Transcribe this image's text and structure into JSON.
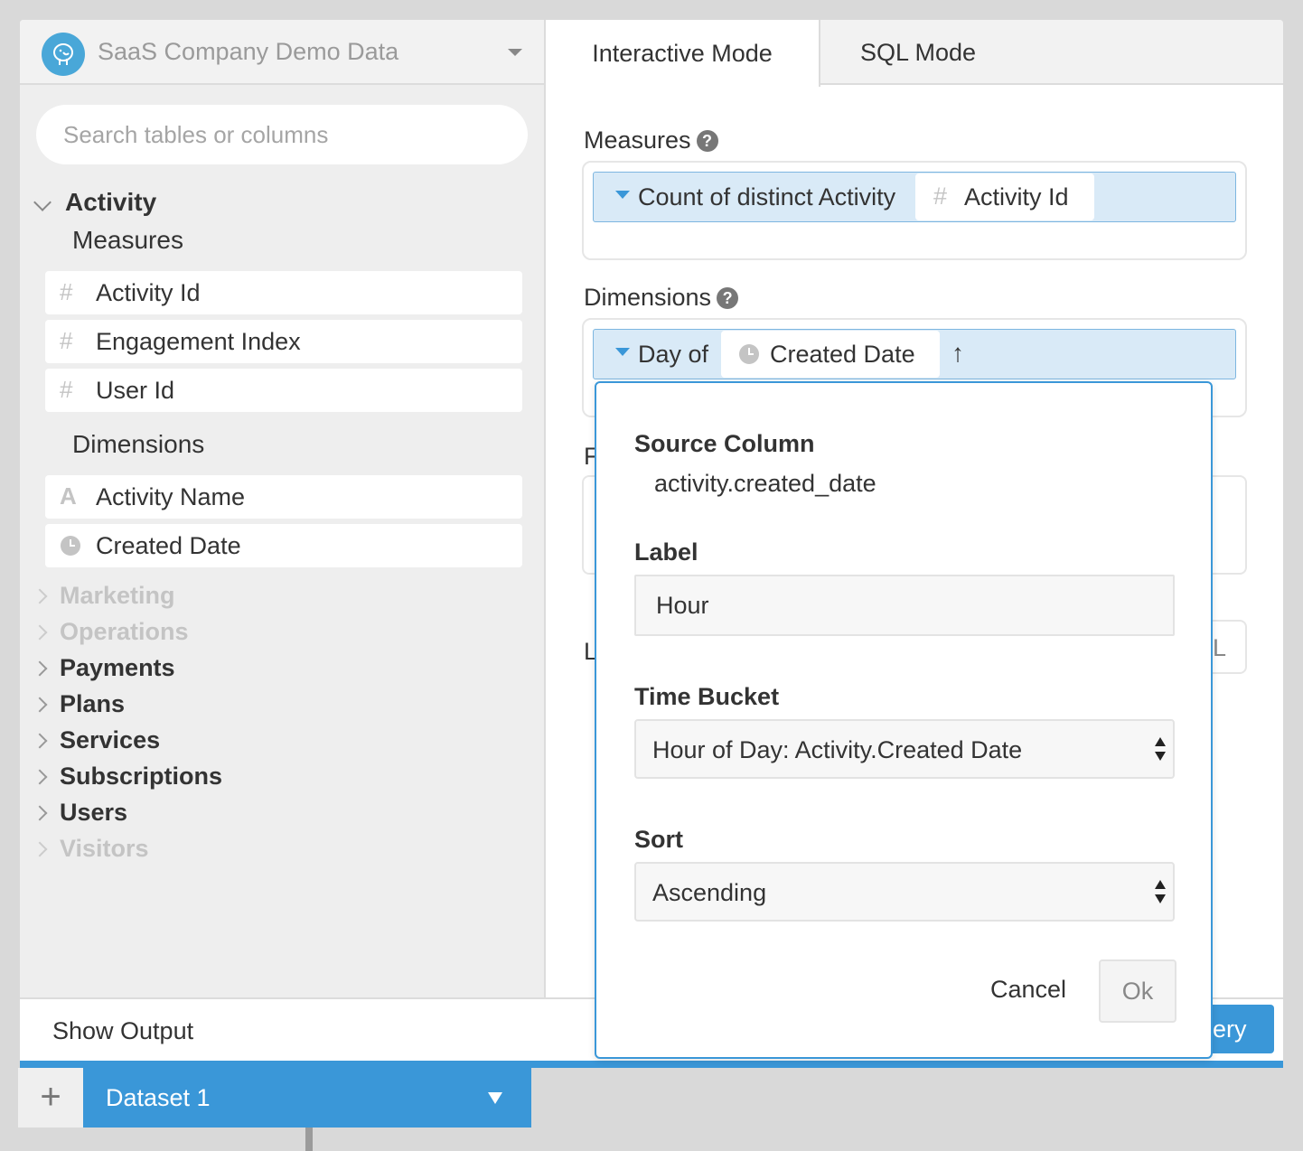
{
  "datasource": {
    "name": "SaaS Company Demo Data",
    "logo_icon": "postgresql-elephant-icon"
  },
  "search": {
    "placeholder": "Search tables or columns",
    "value": ""
  },
  "tree": {
    "open_table": "Activity",
    "measures_label": "Measures",
    "measures": [
      {
        "icon": "#",
        "label": "Activity Id"
      },
      {
        "icon": "#",
        "label": "Engagement Index"
      },
      {
        "icon": "#",
        "label": "User Id"
      }
    ],
    "dimensions_label": "Dimensions",
    "dimensions": [
      {
        "icon": "A",
        "label": "Activity Name"
      },
      {
        "icon": "clock",
        "label": "Created Date"
      }
    ],
    "tables": [
      {
        "label": "Marketing",
        "disabled": true
      },
      {
        "label": "Operations",
        "disabled": true
      },
      {
        "label": "Payments",
        "disabled": false
      },
      {
        "label": "Plans",
        "disabled": false
      },
      {
        "label": "Services",
        "disabled": false
      },
      {
        "label": "Subscriptions",
        "disabled": false
      },
      {
        "label": "Users",
        "disabled": false
      },
      {
        "label": "Visitors",
        "disabled": true
      }
    ]
  },
  "tabs": {
    "interactive": "Interactive Mode",
    "sql": "SQL Mode"
  },
  "builder": {
    "measures_label": "Measures",
    "measure_pill": {
      "aggregation": "Count of distinct Activity",
      "field_icon": "#",
      "field": "Activity Id"
    },
    "dimensions_label": "Dimensions",
    "dimension_pill": {
      "prefix": "Day of",
      "field": "Created Date",
      "sort_arrow": "↑"
    },
    "filters_label_partial": "F",
    "limit_label_partial": "L",
    "limit_button_partial": "L"
  },
  "popover": {
    "source_column_label": "Source Column",
    "source_column_value": "activity.created_date",
    "label_label": "Label",
    "label_value": "Hour",
    "time_bucket_label": "Time Bucket",
    "time_bucket_value": "Hour of Day: Activity.Created Date",
    "sort_label": "Sort",
    "sort_value": "Ascending",
    "cancel": "Cancel",
    "ok": "Ok"
  },
  "bottom": {
    "show_output": "Show Output",
    "run_button_partial": "ery",
    "add_dataset": "+",
    "dataset_tab": "Dataset 1"
  },
  "colors": {
    "accent": "#3a97d8",
    "pill_bg": "#d9eaf7",
    "panel_bg": "#eeeeee"
  }
}
